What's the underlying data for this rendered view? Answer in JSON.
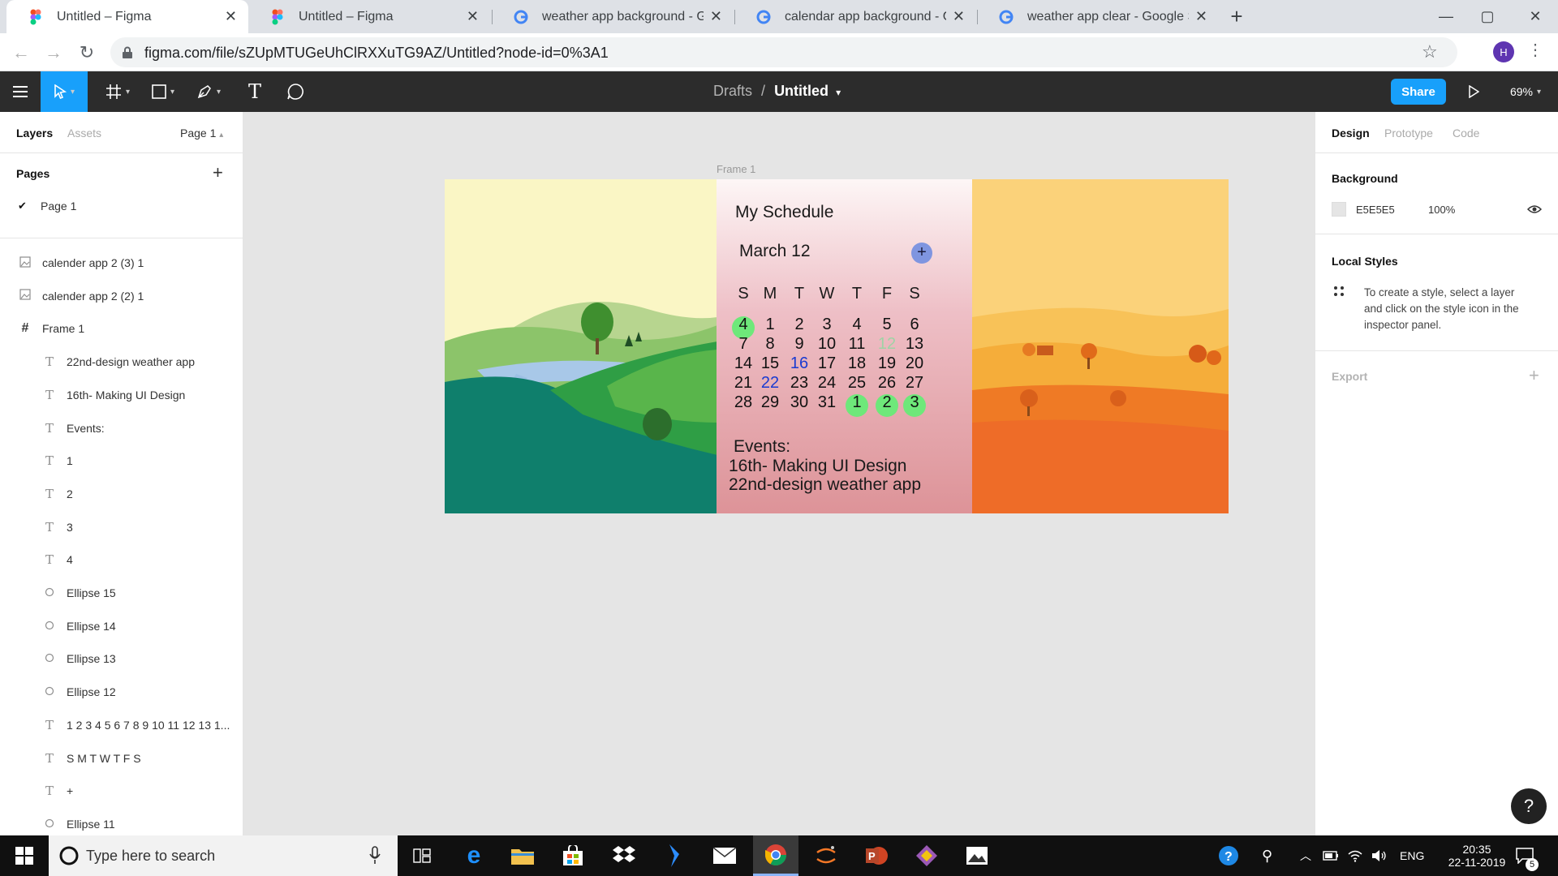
{
  "browser": {
    "tabs": [
      {
        "title": "Untitled – Figma",
        "active": true,
        "icon": "figma-icon"
      },
      {
        "title": "Untitled – Figma",
        "active": false,
        "icon": "figma-icon"
      },
      {
        "title": "weather app background - Goog",
        "active": false,
        "icon": "google-icon"
      },
      {
        "title": "calendar app background - Goog",
        "active": false,
        "icon": "google-icon"
      },
      {
        "title": "weather app clear - Google Searc",
        "active": false,
        "icon": "google-icon"
      }
    ],
    "url": "figma.com/file/sZUpMTUGeUhClRXXuTG9AZ/Untitled?node-id=0%3A1",
    "profile_initial": "H"
  },
  "figma_toolbar": {
    "breadcrumb_parent": "Drafts",
    "breadcrumb_sep": "/",
    "file_name": "Untitled",
    "share_label": "Share",
    "zoom": "69%"
  },
  "left_panel": {
    "tabs": [
      "Layers",
      "Assets"
    ],
    "page_selector": "Page 1",
    "pages_heading": "Pages",
    "pages": [
      "Page 1"
    ],
    "layers": [
      {
        "name": "calender app 2 (3) 1",
        "icon": "image",
        "indent": 0
      },
      {
        "name": "calender app 2 (2) 1",
        "icon": "image",
        "indent": 0
      },
      {
        "name": "Frame 1",
        "icon": "frame",
        "indent": 0
      },
      {
        "name": "22nd-design weather app",
        "icon": "text",
        "indent": 1
      },
      {
        "name": "16th- Making UI Design",
        "icon": "text",
        "indent": 1
      },
      {
        "name": "Events:",
        "icon": "text",
        "indent": 1
      },
      {
        "name": "1",
        "icon": "text",
        "indent": 1
      },
      {
        "name": "2",
        "icon": "text",
        "indent": 1
      },
      {
        "name": "3",
        "icon": "text",
        "indent": 1
      },
      {
        "name": "4",
        "icon": "text",
        "indent": 1
      },
      {
        "name": "Ellipse 15",
        "icon": "ellipse",
        "indent": 1
      },
      {
        "name": "Ellipse 14",
        "icon": "ellipse",
        "indent": 1
      },
      {
        "name": "Ellipse 13",
        "icon": "ellipse",
        "indent": 1
      },
      {
        "name": "Ellipse 12",
        "icon": "ellipse",
        "indent": 1
      },
      {
        "name": "1 2 3 4 5 6 7 8 9 10 11 12 13 1...",
        "icon": "text",
        "indent": 1
      },
      {
        "name": "S M T W T F S",
        "icon": "text",
        "indent": 1
      },
      {
        "name": "+",
        "icon": "text",
        "indent": 1
      },
      {
        "name": "Ellipse 11",
        "icon": "ellipse",
        "indent": 1
      }
    ]
  },
  "canvas": {
    "frame_label": "Frame 1",
    "schedule_title": "My Schedule",
    "date_label": "March 12",
    "add_symbol": "+",
    "weekdays": [
      "S",
      "M",
      "T",
      "W",
      "T",
      "F",
      "S"
    ],
    "weeks": [
      [
        "4",
        "1",
        "2",
        "3",
        "4",
        "5",
        "6"
      ],
      [
        "7",
        "8",
        "9",
        "10",
        "11",
        "12",
        "13"
      ],
      [
        "14",
        "15",
        "16",
        "17",
        "18",
        "19",
        "20"
      ],
      [
        "21",
        "22",
        "23",
        "24",
        "25",
        "26",
        "27"
      ],
      [
        "28",
        "29",
        "30",
        "31",
        "1",
        "2",
        "3"
      ]
    ],
    "events_heading": "Events:",
    "events": [
      "16th- Making UI Design",
      "22nd-design weather app"
    ],
    "colors": {
      "highlight_dot": "#6ee87a",
      "event_date_text": "#1a3bd1",
      "faded_date_text": "#9fd3a6",
      "add_button": "#7f95e0"
    }
  },
  "right_panel": {
    "tabs": [
      "Design",
      "Prototype",
      "Code"
    ],
    "background_heading": "Background",
    "background_hex": "E5E5E5",
    "background_opacity": "100%",
    "local_styles_heading": "Local Styles",
    "local_styles_hint": [
      "To create a style, select a layer",
      "and click on the style icon in the",
      "inspector panel."
    ],
    "export_heading": "Export",
    "help_symbol": "?"
  },
  "taskbar": {
    "search_placeholder": "Type here to search",
    "language": "ENG",
    "time": "20:35",
    "date": "22-11-2019",
    "notification_count": "5"
  }
}
